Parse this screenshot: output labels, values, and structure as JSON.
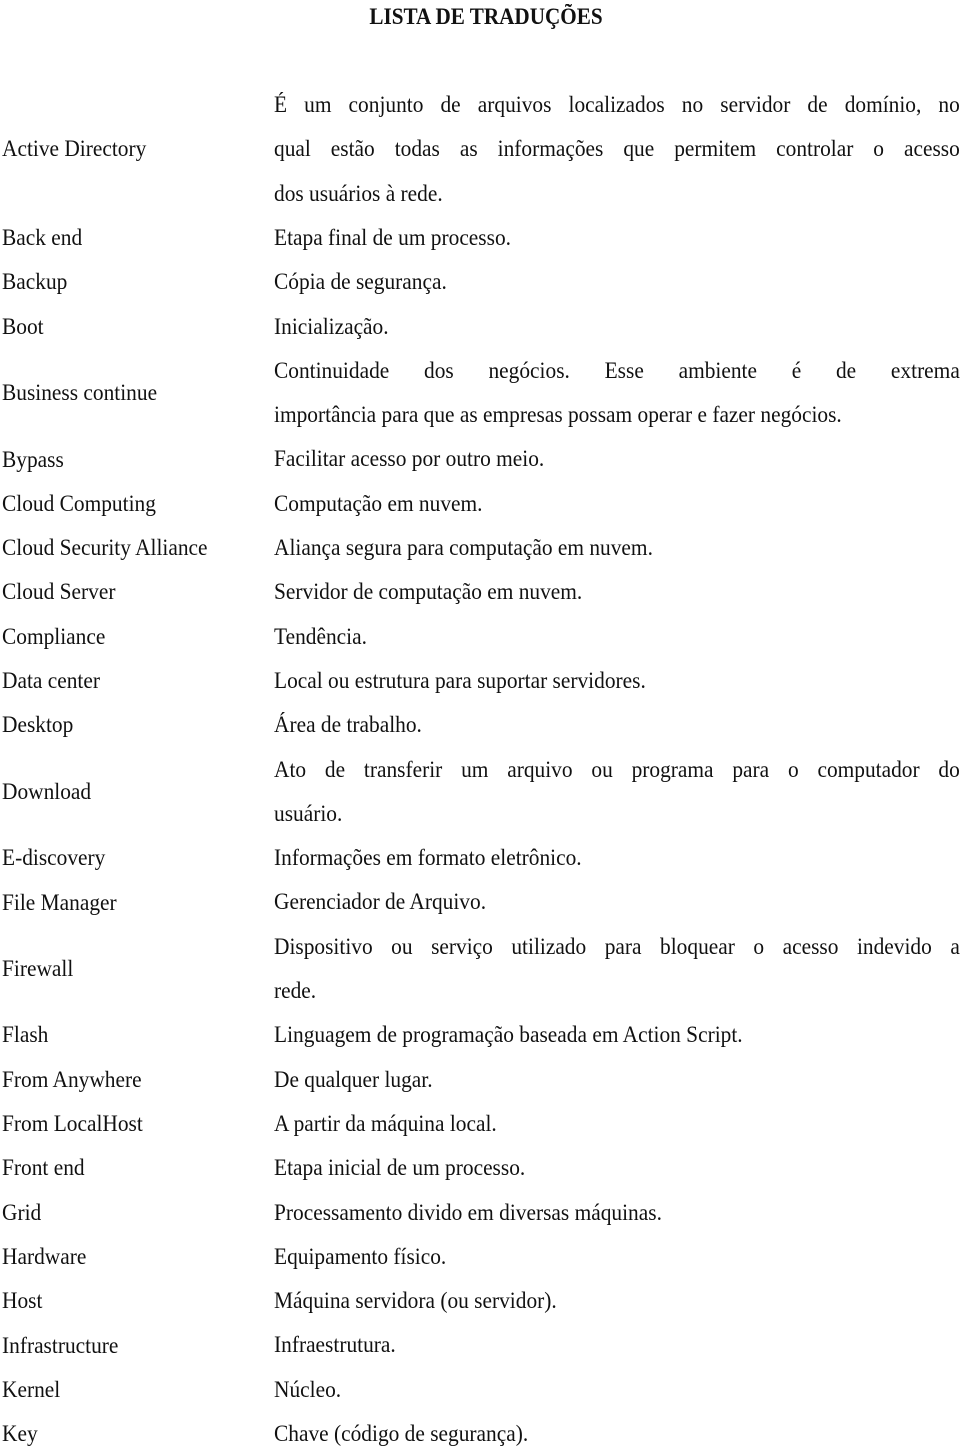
{
  "document": {
    "title": "LISTA DE TRADUÇÕES",
    "entries": [
      {
        "term": "Active Directory",
        "lines": [
          "É um conjunto de arquivos localizados no servidor de domínio, no",
          "qual estão todas as informações que permitem controlar o acesso",
          "dos usuários à rede."
        ]
      },
      {
        "term": "Back end",
        "lines": [
          "Etapa final de um processo."
        ]
      },
      {
        "term": "Backup",
        "lines": [
          "Cópia de segurança."
        ]
      },
      {
        "term": "Boot",
        "lines": [
          "Inicialização."
        ]
      },
      {
        "term": "Business continue",
        "lines": [
          "Continuidade dos negócios. Esse ambiente é de extrema",
          "importância para que as empresas possam operar e fazer negócios."
        ]
      },
      {
        "term": "Bypass",
        "lines": [
          "Facilitar acesso por outro meio."
        ]
      },
      {
        "term": "Cloud Computing",
        "lines": [
          "Computação em nuvem."
        ]
      },
      {
        "term": "Cloud Security Alliance",
        "lines": [
          "Aliança segura para computação em nuvem."
        ]
      },
      {
        "term": "Cloud Server",
        "lines": [
          "Servidor de computação em nuvem."
        ]
      },
      {
        "term": "Compliance",
        "lines": [
          "Tendência."
        ]
      },
      {
        "term": "Data center",
        "lines": [
          "Local ou estrutura para suportar servidores."
        ]
      },
      {
        "term": "Desktop",
        "lines": [
          "Área de trabalho."
        ]
      },
      {
        "term": "Download",
        "lines": [
          "Ato de transferir um arquivo ou programa para o computador do",
          "usuário."
        ]
      },
      {
        "term": "E-discovery",
        "lines": [
          "Informações em formato eletrônico."
        ]
      },
      {
        "term": "File Manager",
        "lines": [
          "Gerenciador de Arquivo."
        ]
      },
      {
        "term": "Firewall",
        "lines": [
          "Dispositivo ou serviço utilizado para bloquear o acesso indevido a",
          "rede."
        ]
      },
      {
        "term": "Flash",
        "lines": [
          "Linguagem de programação baseada em Action Script."
        ]
      },
      {
        "term": "From Anywhere",
        "lines": [
          "De qualquer lugar."
        ]
      },
      {
        "term": "From LocalHost",
        "lines": [
          "A partir da máquina local."
        ]
      },
      {
        "term": "Front end",
        "lines": [
          "Etapa inicial de um processo."
        ]
      },
      {
        "term": "Grid",
        "lines": [
          "Processamento divido em diversas máquinas."
        ]
      },
      {
        "term": "Hardware",
        "lines": [
          "Equipamento físico."
        ]
      },
      {
        "term": "Host",
        "lines": [
          "Máquina servidora (ou servidor)."
        ]
      },
      {
        "term": "Infrastructure",
        "lines": [
          "Infraestrutura."
        ]
      },
      {
        "term": "Kernel",
        "lines": [
          "Núcleo."
        ]
      },
      {
        "term": "Key",
        "lines": [
          "Chave (código de segurança)."
        ]
      }
    ]
  }
}
